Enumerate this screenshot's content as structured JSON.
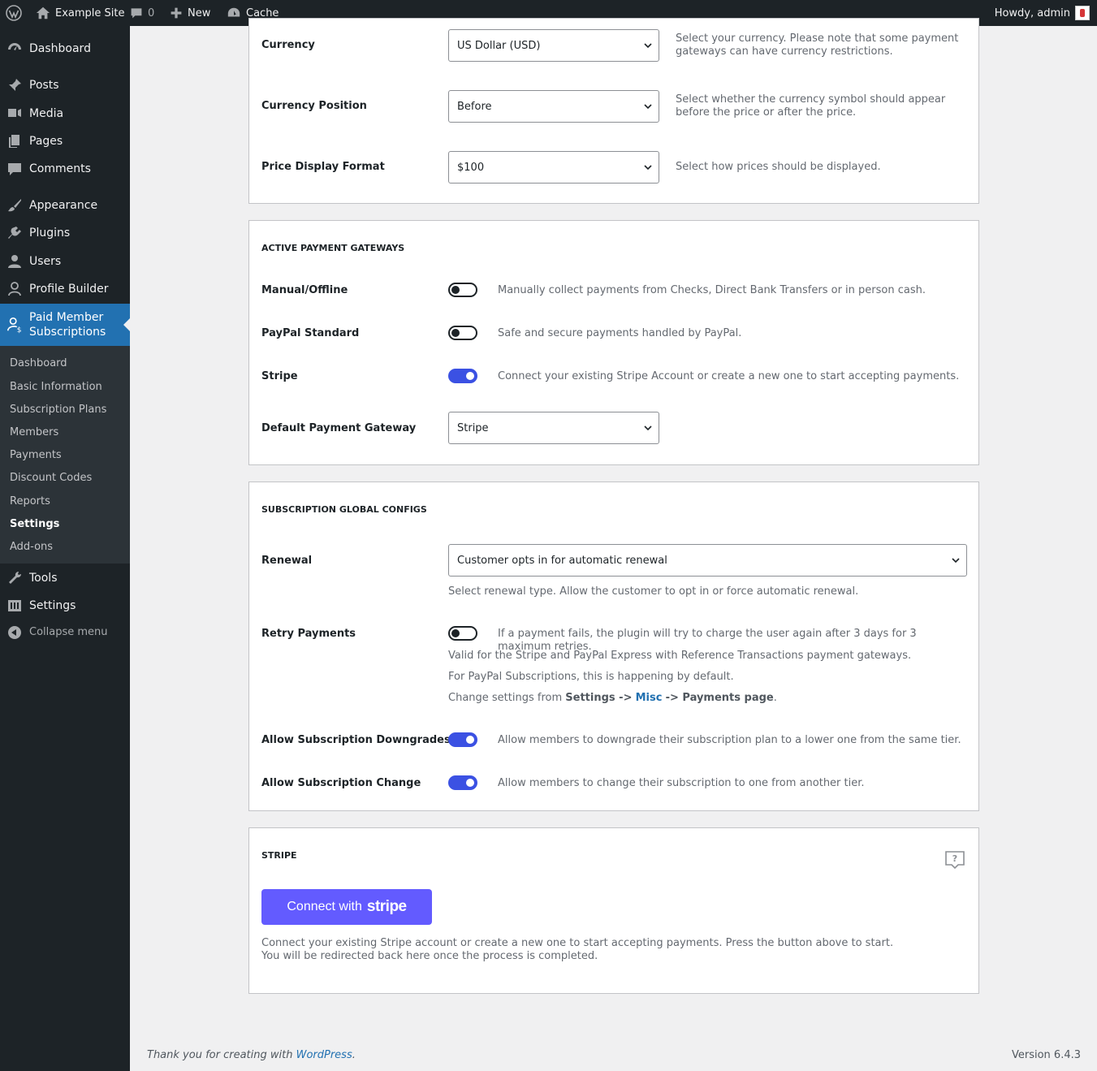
{
  "adminbar": {
    "site_name": "Example Site",
    "comments_count": "0",
    "new_label": "New",
    "cache_label": "Cache",
    "howdy": "Howdy, admin"
  },
  "sidebar": {
    "items": [
      {
        "label": "Dashboard",
        "icon": "dashboard-icon"
      },
      {
        "label": "Posts",
        "icon": "pin-icon"
      },
      {
        "label": "Media",
        "icon": "media-icon"
      },
      {
        "label": "Pages",
        "icon": "pages-icon"
      },
      {
        "label": "Comments",
        "icon": "comment-icon"
      },
      {
        "label": "Appearance",
        "icon": "brush-icon"
      },
      {
        "label": "Plugins",
        "icon": "plugin-icon"
      },
      {
        "label": "Users",
        "icon": "users-icon"
      },
      {
        "label": "Profile Builder",
        "icon": "person-icon"
      },
      {
        "label": "Paid Member Subscriptions",
        "icon": "member-dollar-icon"
      },
      {
        "label": "Tools",
        "icon": "wrench-icon"
      },
      {
        "label": "Settings",
        "icon": "sliders-icon"
      }
    ],
    "submenu": [
      "Dashboard",
      "Basic Information",
      "Subscription Plans",
      "Members",
      "Payments",
      "Discount Codes",
      "Reports",
      "Settings",
      "Add-ons"
    ],
    "collapse_label": "Collapse menu"
  },
  "currency": {
    "currency_label": "Currency",
    "currency_value": "US Dollar (USD)",
    "currency_desc": "Select your currency. Please note that some payment gateways can have currency restrictions.",
    "position_label": "Currency Position",
    "position_value": "Before",
    "position_desc": "Select whether the currency symbol should appear before the price or after the price.",
    "format_label": "Price Display Format",
    "format_value": "$100",
    "format_desc": "Select how prices should be displayed."
  },
  "gateways": {
    "title": "ACTIVE PAYMENT GATEWAYS",
    "manual_label": "Manual/Offline",
    "manual_on": false,
    "manual_desc": "Manually collect payments from Checks, Direct Bank Transfers or in person cash.",
    "paypal_label": "PayPal Standard",
    "paypal_on": false,
    "paypal_desc": "Safe and secure payments handled by PayPal.",
    "stripe_label": "Stripe",
    "stripe_on": true,
    "stripe_desc": "Connect your existing Stripe Account or create a new one to start accepting payments.",
    "default_label": "Default Payment Gateway",
    "default_value": "Stripe"
  },
  "subscription": {
    "title": "SUBSCRIPTION GLOBAL CONFIGS",
    "renewal_label": "Renewal",
    "renewal_value": "Customer opts in for automatic renewal",
    "renewal_desc": "Select renewal type. Allow the customer to opt in or force automatic renewal.",
    "retry_label": "Retry Payments",
    "retry_on": false,
    "retry_desc1": "If a payment fails, the plugin will try to charge the user again after 3 days for 3 maximum retries.",
    "retry_desc2": "Valid for the Stripe and PayPal Express with Reference Transactions payment gateways.",
    "retry_desc3": "For PayPal Subscriptions, this is happening by default.",
    "retry_desc4_prefix": "Change settings from",
    "retry_desc4_settings": "Settings ->",
    "retry_desc4_misc": "Misc",
    "retry_desc4_suffix": "-> Payments page",
    "downgrade_label": "Allow Subscription Downgrades",
    "downgrade_on": true,
    "downgrade_desc": "Allow members to downgrade their subscription plan to a lower one from the same tier.",
    "change_label": "Allow Subscription Change",
    "change_on": true,
    "change_desc": "Allow members to change their subscription to one from another tier."
  },
  "stripe": {
    "title": "STRIPE",
    "button_prefix": "Connect with",
    "button_brand": "stripe",
    "desc1": "Connect your existing Stripe account or create a new one to start accepting payments. Press the button above to start.",
    "desc2": "You will be redirected back here once the process is completed."
  },
  "footer": {
    "thanks_prefix": "Thank you for creating with",
    "wordpress_link": "WordPress",
    "version": "Version 6.4.3"
  }
}
